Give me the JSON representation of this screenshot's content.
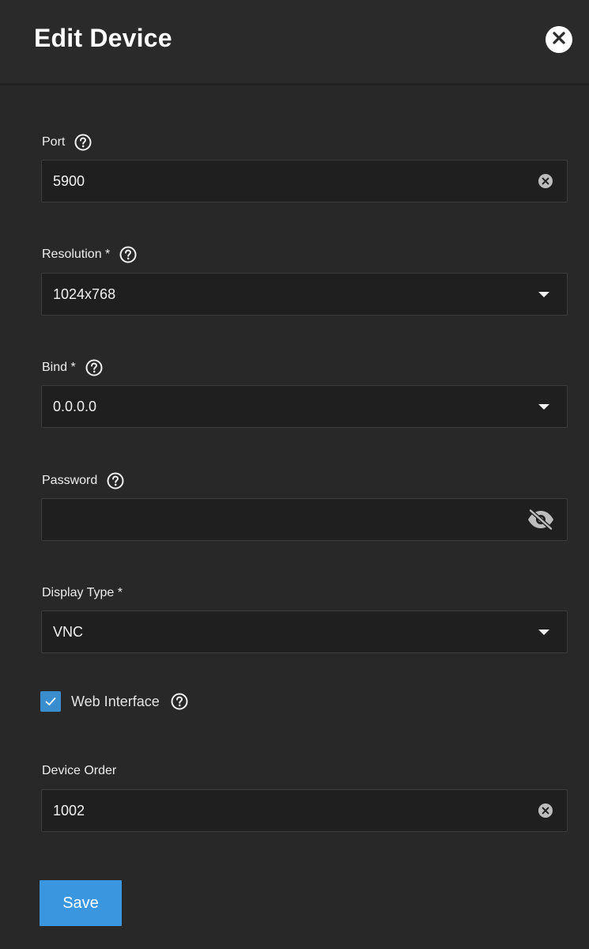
{
  "dialog": {
    "title": "Edit Device"
  },
  "fields": {
    "port": {
      "label": "Port",
      "value": "5900"
    },
    "resolution": {
      "label": "Resolution *",
      "value": "1024x768"
    },
    "bind": {
      "label": "Bind *",
      "value": "0.0.0.0"
    },
    "password": {
      "label": "Password",
      "value": ""
    },
    "display_type": {
      "label": "Display Type *",
      "value": "VNC"
    },
    "web_interface": {
      "label": "Web Interface",
      "checked": true
    },
    "device_order": {
      "label": "Device Order",
      "value": "1002"
    }
  },
  "actions": {
    "save_label": "Save"
  },
  "icons": {
    "close": "close-icon",
    "help": "help-circle-icon",
    "clear": "clear-icon",
    "dropdown": "chevron-down-icon",
    "visibility": "eye-off-icon",
    "check": "check-icon"
  },
  "colors": {
    "background": "#282828",
    "field_background": "#1f1f1f",
    "accent": "#3a96df",
    "checkbox": "#3a8dcd"
  }
}
